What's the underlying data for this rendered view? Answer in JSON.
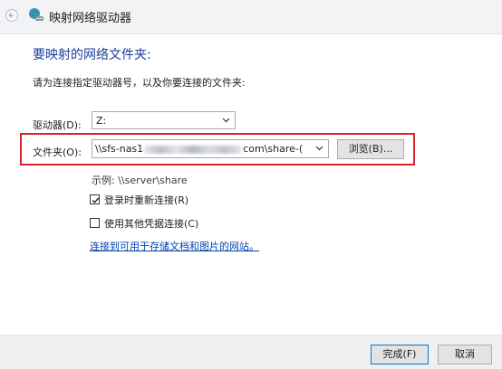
{
  "window": {
    "title": "映射网络驱动器"
  },
  "main": {
    "heading": "要映射的网络文件夹:",
    "instruction": "请为连接指定驱动器号，以及你要连接的文件夹:",
    "drive": {
      "label": "驱动器(D):",
      "value": "Z:"
    },
    "folder": {
      "label": "文件夹(O):",
      "value_start": "\\\\sfs-nas1",
      "value_end": "com\\share-(",
      "browse_label": "浏览(B)..."
    },
    "example": "示例: \\\\server\\share",
    "reconnect": {
      "label": "登录时重新连接(R)",
      "checked": true
    },
    "other_credentials": {
      "label": "使用其他凭据连接(C)",
      "checked": false
    },
    "link": "连接到可用于存储文档和图片的网站。"
  },
  "footer": {
    "finish_label": "完成(F)",
    "cancel_label": "取消"
  },
  "colors": {
    "heading": "#1a3f9a",
    "highlight_border": "#d8232a",
    "link": "#0645ad"
  },
  "icons": [
    "back-arrow-icon",
    "network-drive-icon",
    "chevron-down-icon",
    "checkmark-icon"
  ]
}
